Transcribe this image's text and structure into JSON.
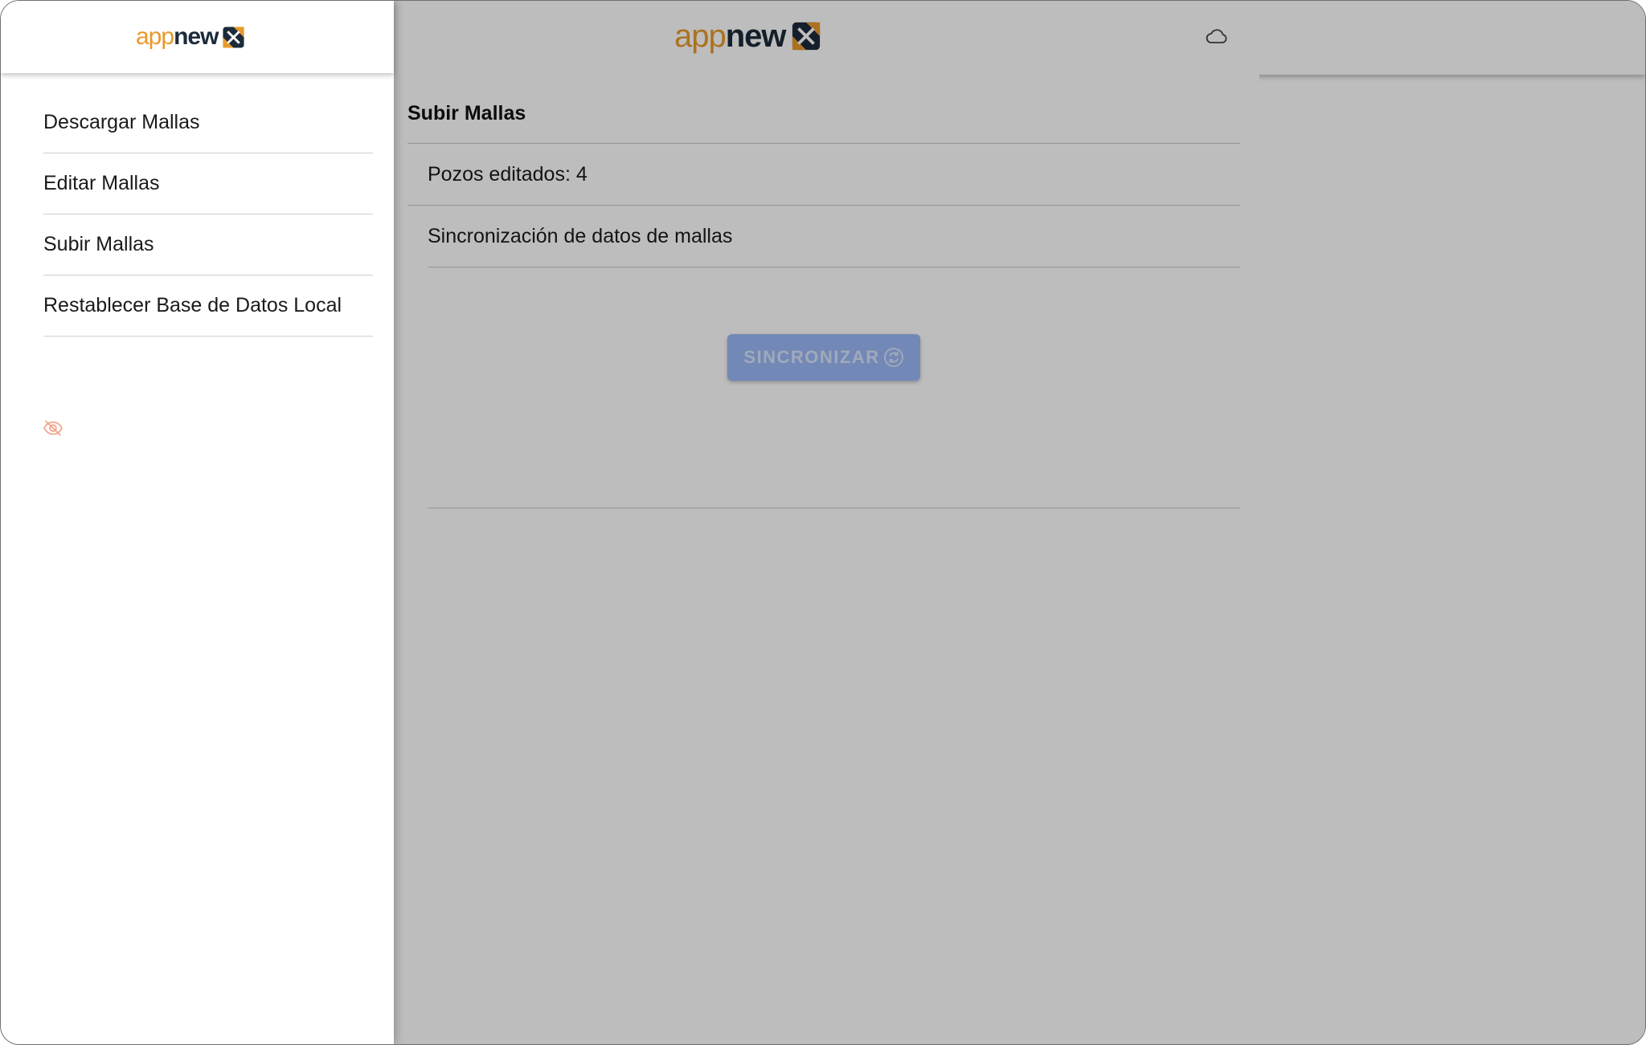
{
  "app": {
    "logo_app": "app",
    "logo_new": "new"
  },
  "colors": {
    "brand_orange": "#e79a2a",
    "brand_navy": "#1c2b3a",
    "button_blue": "#9ab8f6",
    "eye_icon": "#f0a48a"
  },
  "header": {
    "cloud_icon": "cloud-icon"
  },
  "main": {
    "section_title": "Subir Mallas",
    "edited_wells": "Pozos editados: 4",
    "sync_description": "Sincronización de datos de mallas",
    "sync_button_label": "SINCRONIZAR",
    "sync_button_icon": "sync-icon"
  },
  "drawer": {
    "items": [
      {
        "label": "Descargar Mallas"
      },
      {
        "label": "Editar Mallas"
      },
      {
        "label": "Subir Mallas"
      },
      {
        "label": "Restablecer Base de Datos Local"
      }
    ],
    "visibility_icon": "eye-off-icon"
  }
}
